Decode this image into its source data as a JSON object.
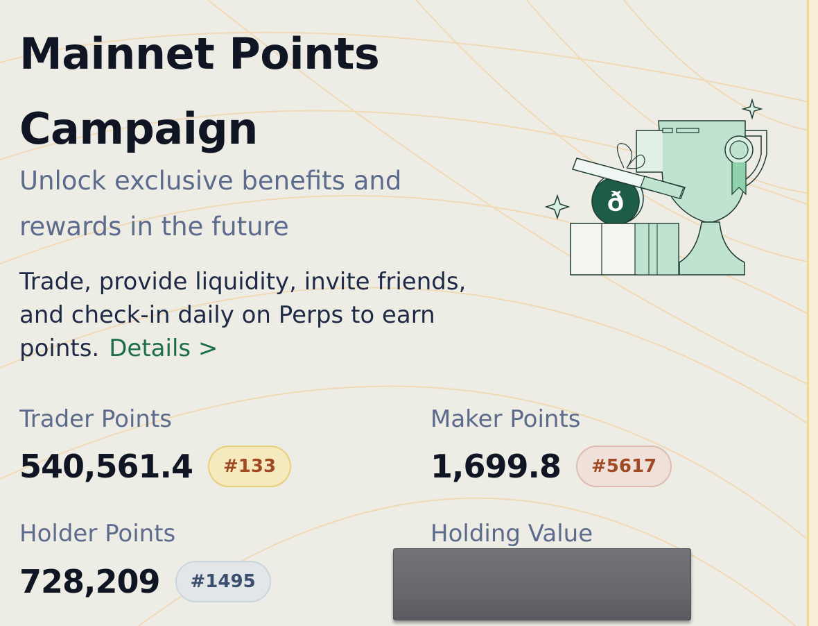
{
  "header": {
    "title": "Mainnet Points Campaign",
    "subtitle": "Unlock exclusive benefits and rewards in the future",
    "description": "Trade, provide liquidity, invite friends, and check-in daily on Perps to earn points.",
    "details_link": "Details >"
  },
  "stats": {
    "trader": {
      "label": "Trader Points",
      "value": "540,561.4",
      "rank": "#133"
    },
    "maker": {
      "label": "Maker Points",
      "value": "1,699.8",
      "rank": "#5617"
    },
    "holder": {
      "label": "Holder Points",
      "value": "728,209",
      "rank": "#1495"
    },
    "holding": {
      "label": "Holding Value"
    }
  },
  "hero": {
    "coin_glyph": "ð"
  },
  "colors": {
    "background": "#edede6",
    "accent_green": "#1b6e46",
    "trophy_green": "#bfe3cf",
    "label_slate": "#5c6b8c"
  }
}
